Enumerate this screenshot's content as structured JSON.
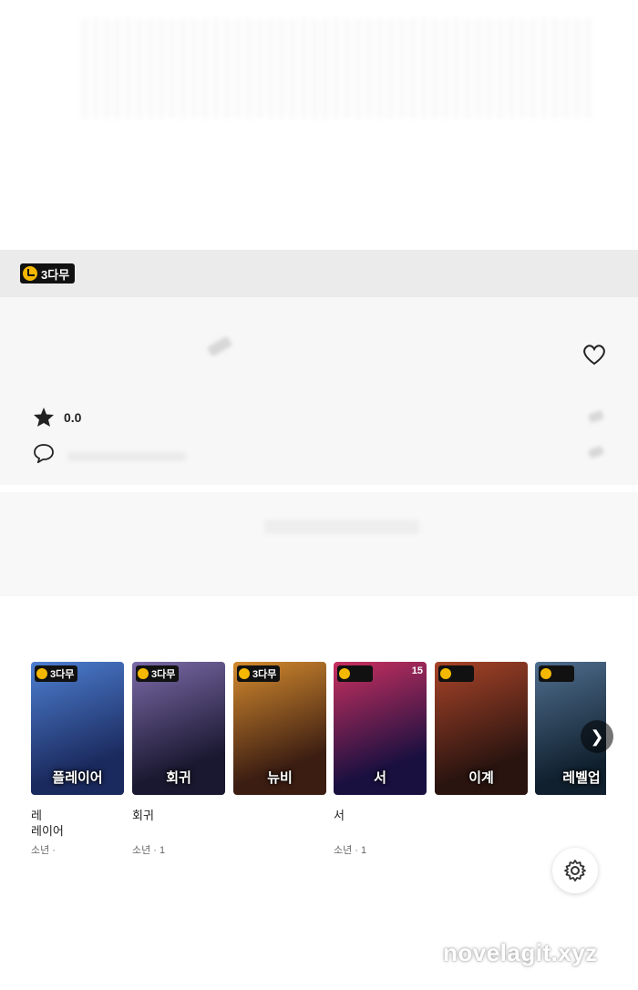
{
  "header": {
    "badge_label": "3다무"
  },
  "detail": {
    "rating": "0.0"
  },
  "carousel": {
    "cards": [
      {
        "badge": "3다무",
        "cover_text": "플레이어",
        "title_line1": "레",
        "title_line2": "레이어",
        "meta": "소년 ·",
        "colors": [
          "#1b2a5e",
          "#4d7fd1"
        ]
      },
      {
        "badge": "3다무",
        "cover_text": "회귀",
        "title_line1": "",
        "title_line2": "회귀",
        "meta": "소년 · 1",
        "colors": [
          "#1a1830",
          "#7b6aa8"
        ]
      },
      {
        "badge": "3다무",
        "cover_text": "뉴비",
        "title_line1": "",
        "title_line2": "",
        "meta": "",
        "colors": [
          "#3b1d12",
          "#d38a2e"
        ]
      },
      {
        "badge": "",
        "number": "15",
        "cover_text": "서",
        "title_line1": "",
        "title_line2": "서",
        "meta": "소년 · 1",
        "colors": [
          "#1a1040",
          "#c83060"
        ]
      },
      {
        "badge": "",
        "cover_text": "이계",
        "title_line1": "",
        "title_line2": "",
        "meta": "",
        "colors": [
          "#2a1410",
          "#a84428"
        ]
      },
      {
        "badge": "",
        "cover_text": "레벨업",
        "title_line1": "",
        "title_line2": "",
        "meta": "",
        "colors": [
          "#10202e",
          "#4f6e8e"
        ]
      }
    ]
  },
  "watermark": "novelagit.xyz",
  "colors": {
    "badge_bg": "#111111",
    "badge_clock": "#f5b800",
    "info_bg": "#f7f7f7"
  }
}
